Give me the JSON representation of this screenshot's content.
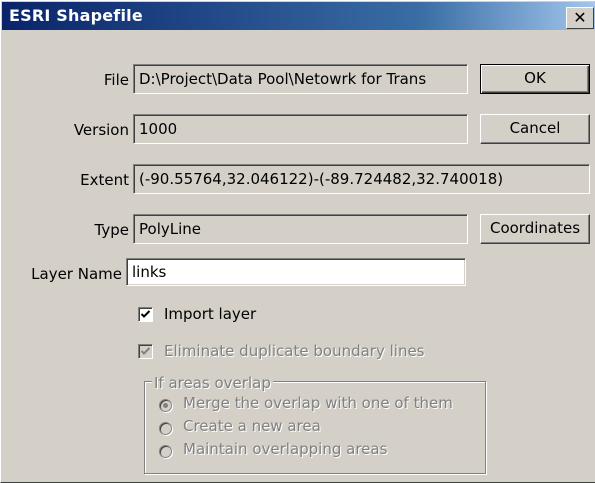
{
  "window": {
    "title": "ESRI Shapefile",
    "close_glyph": "✕"
  },
  "fields": {
    "file": {
      "label": "File",
      "value": "D:\\Project\\Data Pool\\Netowrk for Trans"
    },
    "version": {
      "label": "Version",
      "value": "1000"
    },
    "extent": {
      "label": "Extent",
      "value": "(-90.55764,32.046122)-(-89.724482,32.740018)"
    },
    "type": {
      "label": "Type",
      "value": "PolyLine"
    },
    "layer_name": {
      "label": "Layer Name",
      "value": "links"
    }
  },
  "buttons": {
    "ok": "OK",
    "cancel": "Cancel",
    "coordinates": "Coordinates"
  },
  "options": {
    "import_layer": {
      "label": "Import layer",
      "checked": true,
      "enabled": true
    },
    "eliminate_duplicates": {
      "label": "Eliminate duplicate boundary lines",
      "checked": true,
      "enabled": false
    }
  },
  "overlap_group": {
    "legend": "If areas overlap",
    "options": [
      {
        "label": "Merge the overlap with one of them",
        "selected": true
      },
      {
        "label": "Create a new area",
        "selected": false
      },
      {
        "label": "Maintain overlapping areas",
        "selected": false
      }
    ],
    "enabled": false
  },
  "colors": {
    "dialog_bg": "#d4d0c8",
    "title_start": "#0a246a",
    "title_end": "#a6caf0",
    "disabled_text": "#808080"
  },
  "icons": {
    "close": "close-icon",
    "check": "checkmark-icon",
    "radio": "radio-dot-icon"
  }
}
